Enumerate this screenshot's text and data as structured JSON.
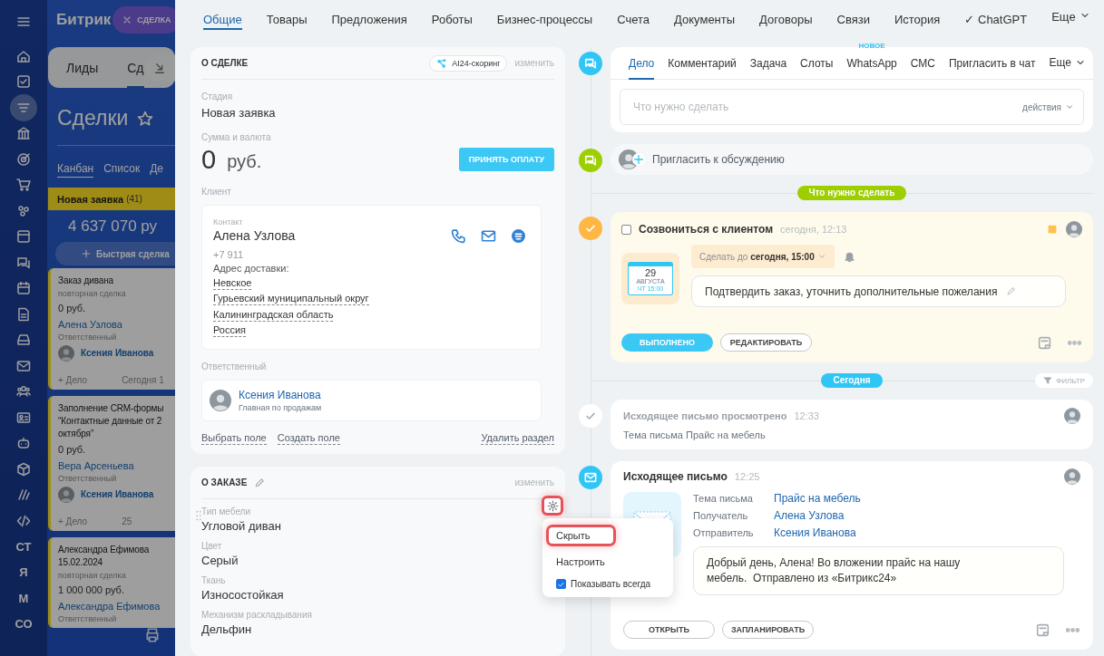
{
  "background": {
    "sidebar": [
      {
        "kind": "menu",
        "selected": false
      },
      {
        "kind": "home",
        "selected": false
      },
      {
        "kind": "tasks",
        "selected": false
      },
      {
        "kind": "filter",
        "selected": true
      },
      {
        "kind": "bank",
        "selected": false
      },
      {
        "kind": "target",
        "selected": false
      },
      {
        "kind": "cart",
        "selected": false
      },
      {
        "kind": "dots",
        "selected": false
      },
      {
        "kind": "window",
        "selected": false
      },
      {
        "kind": "chat",
        "selected": false
      },
      {
        "kind": "calendar",
        "selected": false
      },
      {
        "kind": "document",
        "selected": false
      },
      {
        "kind": "drive",
        "selected": false
      },
      {
        "kind": "mail",
        "selected": false
      },
      {
        "kind": "people",
        "selected": false
      },
      {
        "kind": "card",
        "selected": false
      },
      {
        "kind": "robot",
        "selected": false
      },
      {
        "kind": "box",
        "selected": false
      },
      {
        "kind": "slashes",
        "selected": false
      },
      {
        "kind": "code",
        "selected": false
      },
      {
        "kind": "text",
        "label": "СТ",
        "selected": false
      },
      {
        "kind": "text",
        "label": "Я",
        "selected": false
      },
      {
        "kind": "text",
        "label": "М",
        "selected": false
      },
      {
        "kind": "text",
        "label": "СО",
        "selected": false
      }
    ],
    "logo": "Битрик",
    "slider_chip": "СДЕЛКА",
    "tabs": [
      {
        "label": "Лиды",
        "selected": false
      },
      {
        "label": "Сд",
        "selected": true
      }
    ],
    "title": "Сделки",
    "views": [
      {
        "label": "Канбан",
        "selected": true
      },
      {
        "label": "Список",
        "selected": false
      },
      {
        "label": "Де",
        "selected": false
      }
    ],
    "column": {
      "title": "Новая заявка",
      "count": "(41)",
      "total": "4 637 070 ру",
      "quick_add": "Быстрая сделка"
    },
    "cards": [
      {
        "title": "Заказ дивана",
        "subtitle": "повторная сделка",
        "amount": "0 руб.",
        "contact": "Алена Узлова",
        "responsible_label": "Ответственный",
        "responsible": "Ксения Иванова",
        "add": "+ Дело",
        "date": "Сегодня 1"
      },
      {
        "title": "Заполнение CRM-формы\n“Контактные данные от 2\nоктября”",
        "amount": "0 руб.",
        "contact": "Вера Арсеньева",
        "responsible_label": "Ответственный",
        "responsible": "Ксения Иванова",
        "add": "+ Дело",
        "date": "25"
      },
      {
        "title": "Александра Ефимова\n15.02.2024",
        "subtitle": "повторная сделка",
        "amount": "1 000 000 руб.",
        "contact": "Александра Ефимова",
        "responsible_label": "Ответственный"
      }
    ]
  },
  "tabs": [
    {
      "label": "Общие",
      "selected": true
    },
    {
      "label": "Товары",
      "selected": false
    },
    {
      "label": "Предложения",
      "selected": false
    },
    {
      "label": "Роботы",
      "selected": false
    },
    {
      "label": "Бизнес-процессы",
      "selected": false
    },
    {
      "label": "Счета",
      "selected": false
    },
    {
      "label": "Документы",
      "selected": false
    },
    {
      "label": "Договоры",
      "selected": false
    },
    {
      "label": "Связи",
      "selected": false
    },
    {
      "label": "История",
      "selected": false
    },
    {
      "label": "✓ ChatGPT",
      "selected": false
    }
  ],
  "more_tab": "Еще",
  "deal": {
    "title": "О СДЕЛКЕ",
    "badge": "AI24-скоринг",
    "edit": "изменить",
    "stage_label": "Стадия",
    "stage": "Новая заявка",
    "amount_label": "Сумма и валюта",
    "amount": "0",
    "currency": "руб.",
    "pay_button": "ПРИНЯТЬ ОПЛАТУ",
    "client_label": "Клиент",
    "contact": {
      "label": "Контакт",
      "name": "Алена Узлова",
      "phone": "+7 911",
      "address_label": "Адрес доставки:",
      "address": [
        "Невское",
        "Гурьевский муниципальный округ",
        "Калининградская область",
        "Россия"
      ]
    },
    "responsible_label": "Ответственный",
    "responsible": {
      "name": "Ксения Иванова",
      "position": "Главная по продажам"
    },
    "links": [
      "Выбрать поле",
      "Создать поле"
    ],
    "delete_link": "Удалить раздел"
  },
  "order": {
    "title": "О ЗАКАЗЕ",
    "edit": "изменить",
    "fields": [
      {
        "label": "Тип мебели",
        "value": "Угловой диван",
        "settings_open": true
      },
      {
        "label": "Цвет",
        "value": "Серый",
        "settings_open": false
      },
      {
        "label": "Ткань",
        "value": "Износостойкая",
        "settings_open": false
      },
      {
        "label": "Механизм раскладывания",
        "value": "Дельфин",
        "settings_open": false
      }
    ]
  },
  "field_menu": [
    {
      "kind": "action",
      "label": "Скрыть",
      "highlighted": true
    },
    {
      "kind": "action",
      "label": "Настроить",
      "highlighted": false
    },
    {
      "kind": "checkbox",
      "label": "Показывать всегда",
      "checked": true
    }
  ],
  "timeline": {
    "composer": {
      "tabs": [
        {
          "label": "Дело",
          "selected": true
        },
        {
          "label": "Комментарий",
          "selected": false
        },
        {
          "label": "Задача",
          "selected": false
        },
        {
          "label": "Слоты",
          "selected": false
        },
        {
          "label": "WhatsApp",
          "selected": false,
          "badge": "НОВОЕ"
        },
        {
          "label": "СМС",
          "selected": false
        },
        {
          "label": "Пригласить в чат",
          "selected": false
        }
      ],
      "more": "Еще",
      "placeholder": "Что нужно сделать",
      "actions": "действия"
    },
    "invite": "Пригласить к обсуждению",
    "entries": [
      {
        "kind": "divider",
        "label": "Что нужно сделать",
        "color": "#9dcf00"
      },
      {
        "kind": "task",
        "done": false,
        "title": "Созвониться с клиентом",
        "time": "сегодня, 12:13",
        "calendar": {
          "day": "29",
          "month": "АВГУСТА",
          "time": "ЧТ 15:00"
        },
        "deadline": "Сделать до **сегодня, 15:00**",
        "description": "Подтвердить заказ, уточнить дополнительные пожелания",
        "buttons": [
          {
            "kind": "primary",
            "label": "ВЫПОЛНЕНО"
          },
          {
            "kind": "secondary",
            "label": "РЕДАКТИРОВАТЬ"
          }
        ]
      },
      {
        "kind": "divider",
        "label": "Сегодня",
        "color": "#2fc6f6",
        "filter": "ФИЛЬТР"
      },
      {
        "kind": "email_viewed",
        "title": "Исходящее письмо просмотрено",
        "time": "12:33",
        "text": "Тема письма Прайс на мебель"
      },
      {
        "kind": "email",
        "title": "Исходящее письмо",
        "time": "12:25",
        "fields": [
          {
            "label": "Тема письма",
            "value": "Прайс на мебель"
          },
          {
            "label": "Получатель",
            "value": "Алена Узлова"
          },
          {
            "label": "Отправитель",
            "value": "Ксения Иванова"
          }
        ],
        "message": "Добрый день, Алена! Во вложении прайс на нашу\nмебель.  Отправлено из «Битрикс24»",
        "buttons": [
          {
            "kind": "secondary",
            "label": "ОТКРЫТЬ"
          },
          {
            "kind": "secondary",
            "label": "ЗАПЛАНИРОВАТЬ"
          }
        ]
      }
    ]
  }
}
